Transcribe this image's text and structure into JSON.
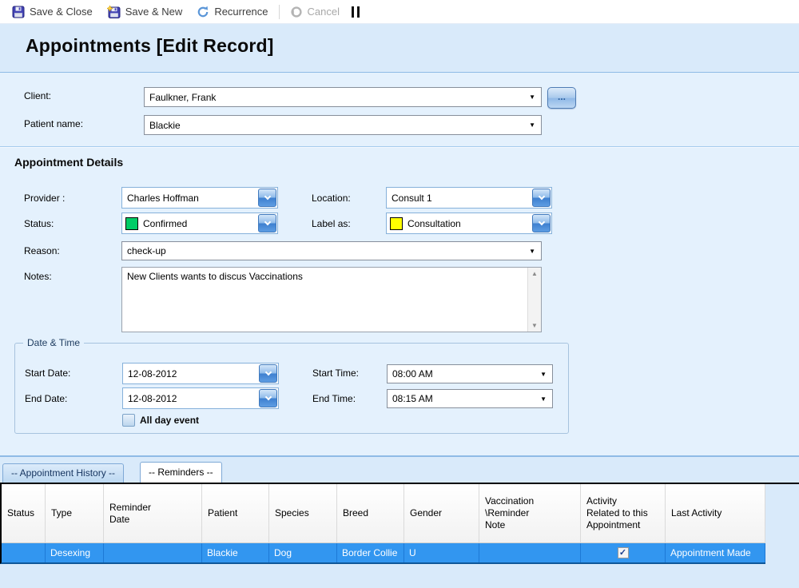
{
  "toolbar": {
    "save_close_label": "Save & Close",
    "save_new_label": "Save & New",
    "recurrence_label": "Recurrence",
    "cancel_label": "Cancel"
  },
  "page_title": "Appointments [Edit Record]",
  "client_section": {
    "client_label": "Client:",
    "client_value": "Faulkner, Frank",
    "patient_label": "Patient name:",
    "patient_value": "Blackie"
  },
  "details": {
    "heading": "Appointment Details",
    "provider_label": "Provider :",
    "provider_value": "Charles Hoffman",
    "location_label": "Location:",
    "location_value": "Consult 1",
    "status_label": "Status:",
    "status_value": "Confirmed",
    "status_color": "#00cc66",
    "label_as_label": "Label as:",
    "label_as_value": "Consultation",
    "label_as_color": "#ffff00",
    "reason_label": "Reason:",
    "reason_value": "check-up",
    "notes_label": "Notes:",
    "notes_value": "New Clients wants to discus Vaccinations"
  },
  "datetime": {
    "legend": "Date & Time",
    "start_date_label": "Start Date:",
    "start_date_value": "12-08-2012",
    "end_date_label": "End Date:",
    "end_date_value": "12-08-2012",
    "start_time_label": "Start Time:",
    "start_time_value": "08:00 AM",
    "end_time_label": "End Time:",
    "end_time_value": "08:15 AM",
    "all_day_label": "All day event"
  },
  "tabs": [
    {
      "label": "-- Appointment History --",
      "active": false
    },
    {
      "label": "-- Reminders --",
      "active": true
    }
  ],
  "reminders_table": {
    "columns": [
      "Status",
      "Type",
      "Reminder\nDate",
      "Patient",
      "Species",
      "Breed",
      "Gender",
      "Vaccination\n\\Reminder\nNote",
      "Activity\nRelated to this\nAppointment",
      "Last Activity"
    ],
    "row": {
      "status": "",
      "type": "Desexing",
      "reminder_date": "",
      "patient": "Blackie",
      "species": "Dog",
      "breed": "Border Collie",
      "gender": "U",
      "note": "",
      "activity_related_checked": true,
      "last_activity": "Appointment Made"
    }
  },
  "icons": {
    "dropdown_arrow": "▼",
    "scroll_up": "▲",
    "scroll_down": "▼",
    "browse": "...",
    "check": "✓"
  },
  "colors": {
    "selected_row": "#3296f0"
  }
}
